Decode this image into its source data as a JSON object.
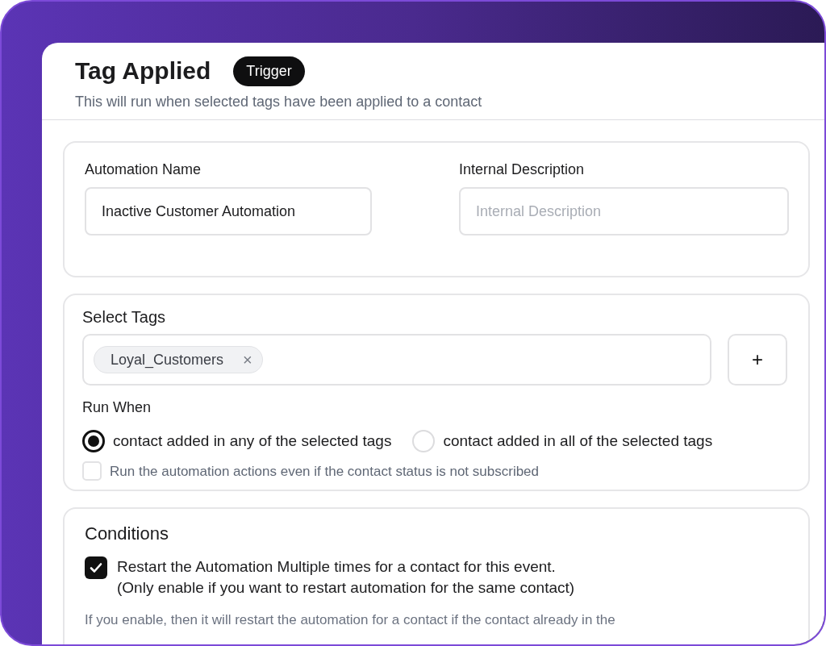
{
  "header": {
    "title": "Tag Applied",
    "badge": "Trigger",
    "subtitle": "This will run when selected tags have been applied to a contact"
  },
  "details": {
    "fields": [
      {
        "label": "Automation Name",
        "value": "Inactive Customer Automation"
      },
      {
        "label": "Internal Description",
        "placeholder": "Internal Description"
      }
    ]
  },
  "tags_section": {
    "label": "Select Tags",
    "tags": [
      {
        "name": "Loyal_Customers",
        "remove": "×"
      }
    ],
    "add_button": "+",
    "run_when": {
      "label": "Run When",
      "options": [
        {
          "label": "contact added in any of the selected tags",
          "selected": true
        },
        {
          "label": "contact added in all of the selected tags",
          "selected": false
        }
      ]
    },
    "unsubscribed_option": {
      "label": "Run the automation actions even if the contact status is not subscribed",
      "checked": false
    }
  },
  "conditions": {
    "title": "Conditions",
    "restart_option": {
      "lines": [
        "Restart the Automation Multiple times for a contact for this event.",
        "(Only enable if you want to restart automation for the same contact)"
      ],
      "checked": true
    },
    "note": "If you enable, then it will restart the automation for a contact if the contact already in the"
  }
}
